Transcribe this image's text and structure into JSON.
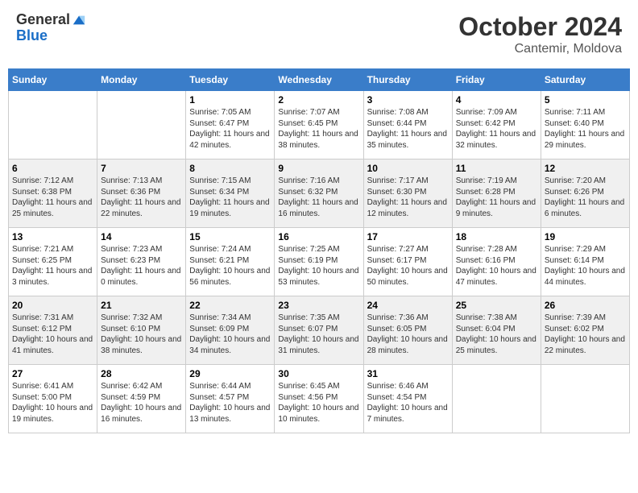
{
  "header": {
    "logo_general": "General",
    "logo_blue": "Blue",
    "title": "October 2024",
    "location": "Cantemir, Moldova"
  },
  "days_of_week": [
    "Sunday",
    "Monday",
    "Tuesday",
    "Wednesday",
    "Thursday",
    "Friday",
    "Saturday"
  ],
  "weeks": [
    [
      {
        "day": "",
        "info": ""
      },
      {
        "day": "",
        "info": ""
      },
      {
        "day": "1",
        "info": "Sunrise: 7:05 AM\nSunset: 6:47 PM\nDaylight: 11 hours and 42 minutes."
      },
      {
        "day": "2",
        "info": "Sunrise: 7:07 AM\nSunset: 6:45 PM\nDaylight: 11 hours and 38 minutes."
      },
      {
        "day": "3",
        "info": "Sunrise: 7:08 AM\nSunset: 6:44 PM\nDaylight: 11 hours and 35 minutes."
      },
      {
        "day": "4",
        "info": "Sunrise: 7:09 AM\nSunset: 6:42 PM\nDaylight: 11 hours and 32 minutes."
      },
      {
        "day": "5",
        "info": "Sunrise: 7:11 AM\nSunset: 6:40 PM\nDaylight: 11 hours and 29 minutes."
      }
    ],
    [
      {
        "day": "6",
        "info": "Sunrise: 7:12 AM\nSunset: 6:38 PM\nDaylight: 11 hours and 25 minutes."
      },
      {
        "day": "7",
        "info": "Sunrise: 7:13 AM\nSunset: 6:36 PM\nDaylight: 11 hours and 22 minutes."
      },
      {
        "day": "8",
        "info": "Sunrise: 7:15 AM\nSunset: 6:34 PM\nDaylight: 11 hours and 19 minutes."
      },
      {
        "day": "9",
        "info": "Sunrise: 7:16 AM\nSunset: 6:32 PM\nDaylight: 11 hours and 16 minutes."
      },
      {
        "day": "10",
        "info": "Sunrise: 7:17 AM\nSunset: 6:30 PM\nDaylight: 11 hours and 12 minutes."
      },
      {
        "day": "11",
        "info": "Sunrise: 7:19 AM\nSunset: 6:28 PM\nDaylight: 11 hours and 9 minutes."
      },
      {
        "day": "12",
        "info": "Sunrise: 7:20 AM\nSunset: 6:26 PM\nDaylight: 11 hours and 6 minutes."
      }
    ],
    [
      {
        "day": "13",
        "info": "Sunrise: 7:21 AM\nSunset: 6:25 PM\nDaylight: 11 hours and 3 minutes."
      },
      {
        "day": "14",
        "info": "Sunrise: 7:23 AM\nSunset: 6:23 PM\nDaylight: 11 hours and 0 minutes."
      },
      {
        "day": "15",
        "info": "Sunrise: 7:24 AM\nSunset: 6:21 PM\nDaylight: 10 hours and 56 minutes."
      },
      {
        "day": "16",
        "info": "Sunrise: 7:25 AM\nSunset: 6:19 PM\nDaylight: 10 hours and 53 minutes."
      },
      {
        "day": "17",
        "info": "Sunrise: 7:27 AM\nSunset: 6:17 PM\nDaylight: 10 hours and 50 minutes."
      },
      {
        "day": "18",
        "info": "Sunrise: 7:28 AM\nSunset: 6:16 PM\nDaylight: 10 hours and 47 minutes."
      },
      {
        "day": "19",
        "info": "Sunrise: 7:29 AM\nSunset: 6:14 PM\nDaylight: 10 hours and 44 minutes."
      }
    ],
    [
      {
        "day": "20",
        "info": "Sunrise: 7:31 AM\nSunset: 6:12 PM\nDaylight: 10 hours and 41 minutes."
      },
      {
        "day": "21",
        "info": "Sunrise: 7:32 AM\nSunset: 6:10 PM\nDaylight: 10 hours and 38 minutes."
      },
      {
        "day": "22",
        "info": "Sunrise: 7:34 AM\nSunset: 6:09 PM\nDaylight: 10 hours and 34 minutes."
      },
      {
        "day": "23",
        "info": "Sunrise: 7:35 AM\nSunset: 6:07 PM\nDaylight: 10 hours and 31 minutes."
      },
      {
        "day": "24",
        "info": "Sunrise: 7:36 AM\nSunset: 6:05 PM\nDaylight: 10 hours and 28 minutes."
      },
      {
        "day": "25",
        "info": "Sunrise: 7:38 AM\nSunset: 6:04 PM\nDaylight: 10 hours and 25 minutes."
      },
      {
        "day": "26",
        "info": "Sunrise: 7:39 AM\nSunset: 6:02 PM\nDaylight: 10 hours and 22 minutes."
      }
    ],
    [
      {
        "day": "27",
        "info": "Sunrise: 6:41 AM\nSunset: 5:00 PM\nDaylight: 10 hours and 19 minutes."
      },
      {
        "day": "28",
        "info": "Sunrise: 6:42 AM\nSunset: 4:59 PM\nDaylight: 10 hours and 16 minutes."
      },
      {
        "day": "29",
        "info": "Sunrise: 6:44 AM\nSunset: 4:57 PM\nDaylight: 10 hours and 13 minutes."
      },
      {
        "day": "30",
        "info": "Sunrise: 6:45 AM\nSunset: 4:56 PM\nDaylight: 10 hours and 10 minutes."
      },
      {
        "day": "31",
        "info": "Sunrise: 6:46 AM\nSunset: 4:54 PM\nDaylight: 10 hours and 7 minutes."
      },
      {
        "day": "",
        "info": ""
      },
      {
        "day": "",
        "info": ""
      }
    ]
  ]
}
